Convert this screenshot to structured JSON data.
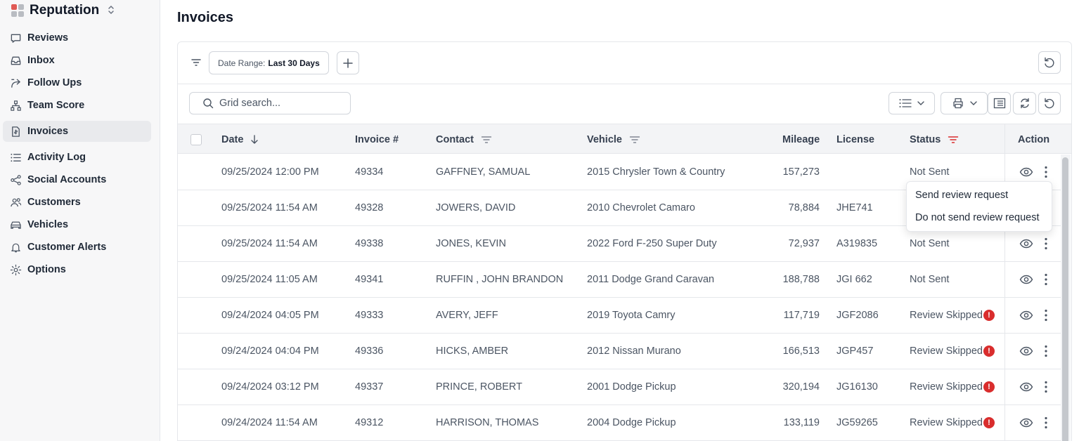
{
  "brand": {
    "name": "Reputation",
    "colors": [
      "#e05a55",
      "#b9bcc2",
      "#b9bcc2",
      "#b9bcc2"
    ]
  },
  "sidebar": {
    "items": [
      {
        "label": "Reviews",
        "icon": "chat-bubble-icon",
        "active": false
      },
      {
        "label": "Inbox",
        "icon": "inbox-icon",
        "active": false
      },
      {
        "label": "Follow Ups",
        "icon": "share-arrow-icon",
        "active": false
      },
      {
        "label": "Team Score",
        "icon": "org-chart-icon",
        "active": false
      },
      {
        "label": "Invoices",
        "icon": "invoice-icon",
        "active": true
      },
      {
        "label": "Activity Log",
        "icon": "list-icon",
        "active": false
      },
      {
        "label": "Social Accounts",
        "icon": "share-nodes-icon",
        "active": false
      },
      {
        "label": "Customers",
        "icon": "users-icon",
        "active": false
      },
      {
        "label": "Vehicles",
        "icon": "car-icon",
        "active": false
      },
      {
        "label": "Customer Alerts",
        "icon": "bell-icon",
        "active": false
      },
      {
        "label": "Options",
        "icon": "gear-icon",
        "active": false
      }
    ]
  },
  "page": {
    "title": "Invoices"
  },
  "filters": {
    "date_range_key": "Date Range:",
    "date_range_value": "Last 30 Days"
  },
  "search": {
    "placeholder": "Grid search..."
  },
  "table": {
    "headers": {
      "date": "Date",
      "invoice": "Invoice #",
      "contact": "Contact",
      "vehicle": "Vehicle",
      "mileage": "Mileage",
      "license": "License",
      "status": "Status",
      "action": "Action"
    },
    "rows": [
      {
        "date": "09/25/2024 12:00 PM",
        "invoice": "49334",
        "contact": "GAFFNEY, SAMUAL",
        "vehicle": "2015 Chrysler Town & Country",
        "mileage": "157,273",
        "license": "",
        "status": "Not Sent",
        "alert": false
      },
      {
        "date": "09/25/2024 11:54 AM",
        "invoice": "49328",
        "contact": "JOWERS, DAVID",
        "vehicle": "2010 Chevrolet Camaro",
        "mileage": "78,884",
        "license": "JHE741",
        "status": "",
        "alert": false
      },
      {
        "date": "09/25/2024 11:54 AM",
        "invoice": "49338",
        "contact": "JONES, KEVIN",
        "vehicle": "2022 Ford F-250 Super Duty",
        "mileage": "72,937",
        "license": "A319835",
        "status": "Not Sent",
        "alert": false
      },
      {
        "date": "09/25/2024 11:05 AM",
        "invoice": "49341",
        "contact": "RUFFIN , JOHN BRANDON",
        "vehicle": "2011 Dodge Grand Caravan",
        "mileage": "188,788",
        "license": "JGI 662",
        "status": "Not Sent",
        "alert": false
      },
      {
        "date": "09/24/2024 04:05 PM",
        "invoice": "49333",
        "contact": "AVERY, JEFF",
        "vehicle": "2019 Toyota Camry",
        "mileage": "117,719",
        "license": "JGF2086",
        "status": "Review Skipped",
        "alert": true
      },
      {
        "date": "09/24/2024 04:04 PM",
        "invoice": "49336",
        "contact": "HICKS, AMBER",
        "vehicle": "2012 Nissan Murano",
        "mileage": "166,513",
        "license": "JGP457",
        "status": "Review Skipped",
        "alert": true
      },
      {
        "date": "09/24/2024 03:12 PM",
        "invoice": "49337",
        "contact": "PRINCE, ROBERT",
        "vehicle": "2001 Dodge Pickup",
        "mileage": "320,194",
        "license": "JG16130",
        "status": "Review Skipped",
        "alert": true
      },
      {
        "date": "09/24/2024 11:54 AM",
        "invoice": "49312",
        "contact": "HARRISON, THOMAS",
        "vehicle": "2004 Dodge Pickup",
        "mileage": "133,119",
        "license": "JG59265",
        "status": "Review Skipped",
        "alert": true
      }
    ]
  },
  "menu": {
    "items": [
      "Send review request",
      "Do not send review request"
    ]
  },
  "alert_glyph": "!",
  "colors": {
    "accent_red": "#d92d2d",
    "active_bg": "#e9eaed"
  }
}
